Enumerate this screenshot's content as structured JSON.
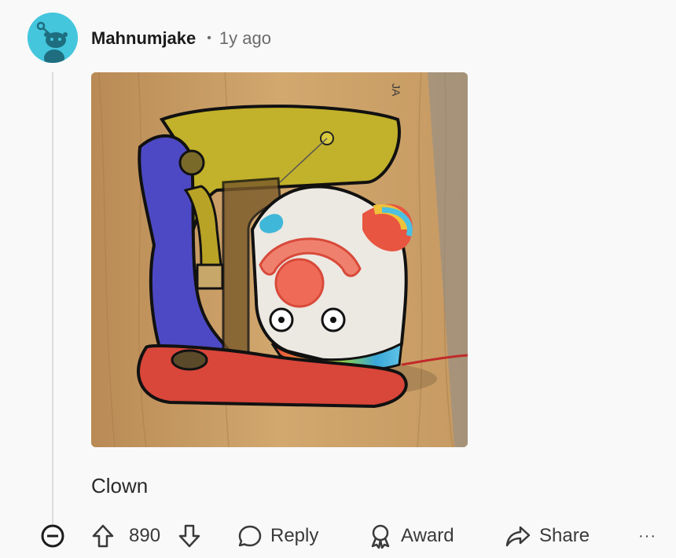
{
  "comment": {
    "username": "Mahnumjake",
    "separator": "•",
    "time_ago": "1y ago",
    "body": "Clown",
    "image_label": "JA"
  },
  "actions": {
    "score": "890",
    "reply_label": "Reply",
    "award_label": "Award",
    "share_label": "Share",
    "more_label": "···"
  },
  "icons": {
    "collapse": "minus-circle-icon",
    "upvote": "arrow-up-icon",
    "downvote": "arrow-down-icon",
    "reply": "speech-bubble-icon",
    "award": "award-ribbon-icon",
    "share": "share-arrow-icon",
    "more": "ellipsis-icon"
  },
  "colors": {
    "avatar_bg": "#44c6dd",
    "thread_line": "#dcdcdc",
    "text_muted": "#6b6b6b"
  }
}
